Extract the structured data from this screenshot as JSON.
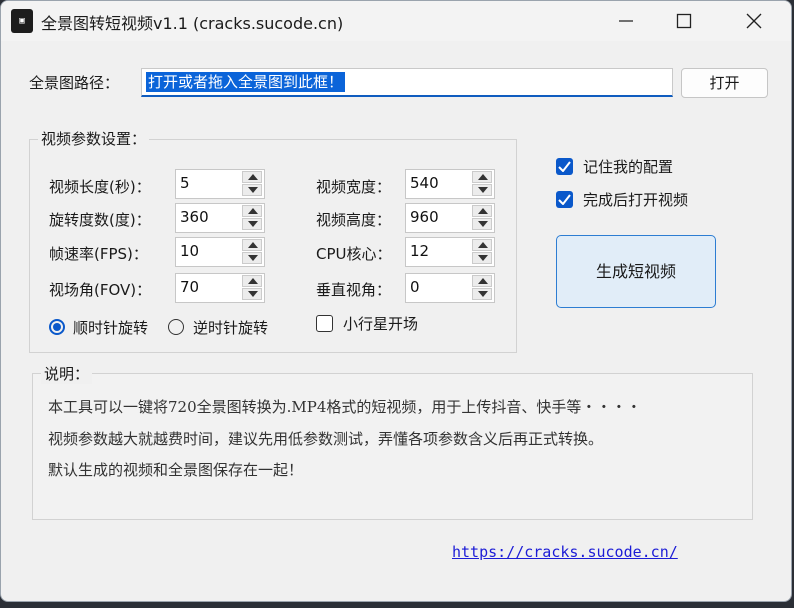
{
  "window": {
    "title": "全景图转短视频v1.1 (cracks.sucode.cn)",
    "icon_text": "▣"
  },
  "path": {
    "label": "全景图路径：",
    "value": "打开或者拖入全景图到此框！",
    "open_button": "打开"
  },
  "params": {
    "group_title": "视频参数设置：",
    "fields": [
      {
        "label": "视频长度(秒)：",
        "value": "5"
      },
      {
        "label": "旋转度数(度)：",
        "value": "360"
      },
      {
        "label": "帧速率(FPS)：",
        "value": "10"
      },
      {
        "label": "视场角(FOV)：",
        "value": "70"
      },
      {
        "label": "视频宽度：",
        "value": "540"
      },
      {
        "label": "视频高度：",
        "value": "960"
      },
      {
        "label": "CPU核心：",
        "value": "12"
      },
      {
        "label": "垂直视角：",
        "value": "0"
      }
    ],
    "radio_cw": "顺时针旋转",
    "radio_ccw": "逆时针旋转",
    "rotation_selected": "顺时针旋转",
    "little_planet": "小行星开场",
    "little_planet_checked": false
  },
  "options": {
    "remember": "记住我的配置",
    "remember_checked": true,
    "open_after": "完成后打开视频",
    "open_after_checked": true,
    "generate_button": "生成短视频"
  },
  "description": {
    "title": "说明：",
    "lines": [
      "本工具可以一键将720全景图转换为.MP4格式的短视频，用于上传抖音、快手等・・・・",
      "视频参数越大就越费时间，建议先用低参数测试，弄懂各项参数含义后再正式转换。",
      "默认生成的视频和全景图保存在一起！"
    ]
  },
  "footer": {
    "link": "https://cracks.sucode.cn/"
  },
  "colors": {
    "accent": "#0a58ca",
    "link": "#1c1cd6"
  }
}
